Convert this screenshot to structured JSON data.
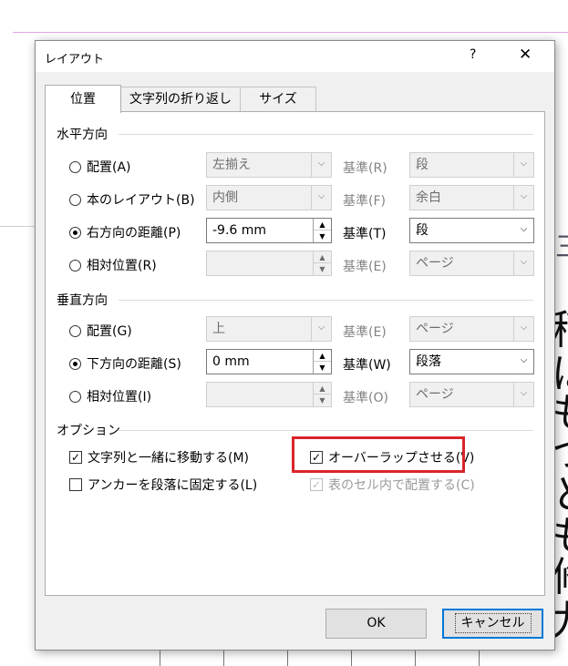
{
  "dialog": {
    "title": "レイアウト",
    "help": "?",
    "close": "✕"
  },
  "tabs": [
    {
      "label": "位置",
      "active": true
    },
    {
      "label": "文字列の折り返し",
      "active": false
    },
    {
      "label": "サイズ",
      "active": false
    }
  ],
  "horizontal": {
    "title": "水平方向",
    "rows": [
      {
        "label": "配置(A)",
        "selected": false,
        "value": "左揃え",
        "base_label": "基準(R)",
        "base_value": "段",
        "enabled": false
      },
      {
        "label": "本のレイアウト(B)",
        "selected": false,
        "value": "内側",
        "base_label": "基準(F)",
        "base_value": "余白",
        "enabled": false
      },
      {
        "label": "右方向の距離(P)",
        "selected": true,
        "value": "-9.6 mm",
        "base_label": "基準(T)",
        "base_value": "段",
        "enabled": true
      },
      {
        "label": "相対位置(R)",
        "selected": false,
        "value": "",
        "base_label": "基準(E)",
        "base_value": "ページ",
        "enabled": false
      }
    ]
  },
  "vertical": {
    "title": "垂直方向",
    "rows": [
      {
        "label": "配置(G)",
        "selected": false,
        "value": "上",
        "base_label": "基準(E)",
        "base_value": "ページ",
        "enabled": false
      },
      {
        "label": "下方向の距離(S)",
        "selected": true,
        "value": "0 mm",
        "base_label": "基準(W)",
        "base_value": "段落",
        "enabled": true
      },
      {
        "label": "相対位置(I)",
        "selected": false,
        "value": "",
        "base_label": "基準(O)",
        "base_value": "ページ",
        "enabled": false
      }
    ]
  },
  "options": {
    "title": "オプション",
    "move_with_text": {
      "label": "文字列と一緒に移動する(M)",
      "checked": true
    },
    "lock_anchor": {
      "label": "アンカーを段落に固定する(L)",
      "checked": false
    },
    "allow_overlap": {
      "label": "オーバーラップさせる(V)",
      "checked": true
    },
    "layout_in_cell": {
      "label": "表のセル内で配置する(C)",
      "checked": true,
      "enabled": false
    }
  },
  "buttons": {
    "ok": "OK",
    "cancel": "キャンセル"
  },
  "background_glyphs": [
    "稻",
    "ほ",
    "も",
    "つ",
    "と",
    "も",
    "修",
    "九"
  ],
  "icons": {
    "checkmark": "✓",
    "dropdown": "⌵",
    "spin_up": "▲",
    "spin_down": "▼"
  },
  "colors": {
    "highlight": "#d9252a",
    "accent": "#0078d7"
  }
}
